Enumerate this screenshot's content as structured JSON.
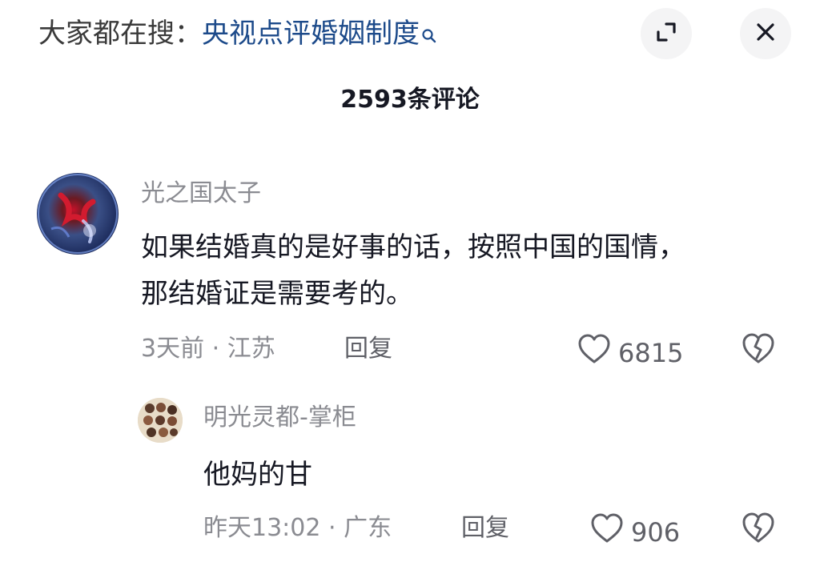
{
  "header": {
    "search_prefix": "大家都在搜：",
    "search_query": "央视点评婚姻制度",
    "search_icon": "search-icon",
    "expand_icon": "expand-icon",
    "close_icon": "close-icon"
  },
  "comments_count_label": "2593条评论",
  "comments": [
    {
      "username": "光之国太子",
      "text_lines": [
        "如果结婚真的是好事的话，按照中国的国情，",
        "那结婚证是需要考的。"
      ],
      "time_location": "3天前 · 江苏",
      "reply_label": "回复",
      "likes": "6815"
    }
  ],
  "replies": [
    {
      "username": "明光灵都-掌柜",
      "text": "他妈的甘",
      "time_location": "昨天13:02 · 广东",
      "reply_label": "回复",
      "likes": "906"
    }
  ],
  "colors": {
    "query_link": "#1c4a8a",
    "secondary_text": "#8a8b91",
    "primary_text": "#161823"
  }
}
